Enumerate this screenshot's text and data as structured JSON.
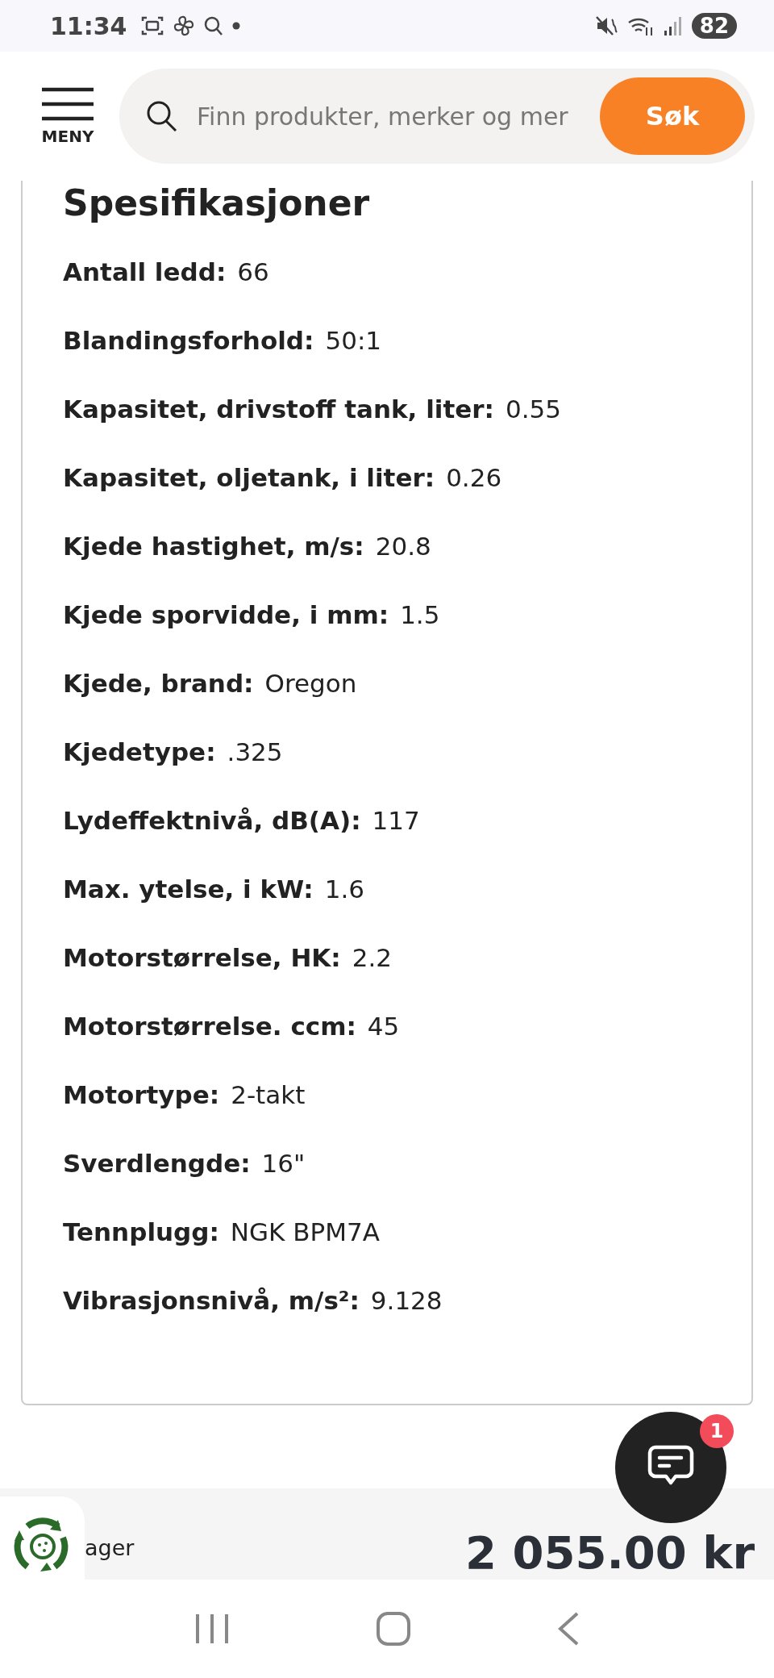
{
  "status_bar": {
    "time": "11:34",
    "battery": "82"
  },
  "header": {
    "menu_label": "MENY",
    "search": {
      "placeholder": "Finn produkter, merker og mer"
    },
    "search_button": "Søk"
  },
  "specs": {
    "title": "Spesifikasjoner",
    "rows": [
      {
        "label": "Antall ledd:",
        "value": "66"
      },
      {
        "label": "Blandingsforhold:",
        "value": "50:1"
      },
      {
        "label": "Kapasitet, drivstoff tank, liter:",
        "value": "0.55"
      },
      {
        "label": "Kapasitet, oljetank, i liter:",
        "value": "0.26"
      },
      {
        "label": "Kjede hastighet, m/s:",
        "value": "20.8"
      },
      {
        "label": "Kjede sporvidde, i mm:",
        "value": "1.5"
      },
      {
        "label": "Kjede, brand:",
        "value": "Oregon"
      },
      {
        "label": "Kjedetype:",
        "value": ".325"
      },
      {
        "label": "Lydeffektnivå, dB(A):",
        "value": "117"
      },
      {
        "label": "Max. ytelse, i kW:",
        "value": "1.6"
      },
      {
        "label": "Motorstørrelse, HK:",
        "value": "2.2"
      },
      {
        "label": "Motorstørrelse. ccm:",
        "value": "45"
      },
      {
        "label": "Motortype:",
        "value": "2-takt"
      },
      {
        "label": "Sverdlengde:",
        "value": "16\""
      },
      {
        "label": "Tennplugg:",
        "value": "NGK BPM7A"
      },
      {
        "label": "Vibrasjonsnivå, m/s²:",
        "value": "9.128"
      }
    ]
  },
  "chat": {
    "badge": "1"
  },
  "bottom_bar": {
    "stock_text": "ager",
    "price": "2 055.00 kr"
  }
}
